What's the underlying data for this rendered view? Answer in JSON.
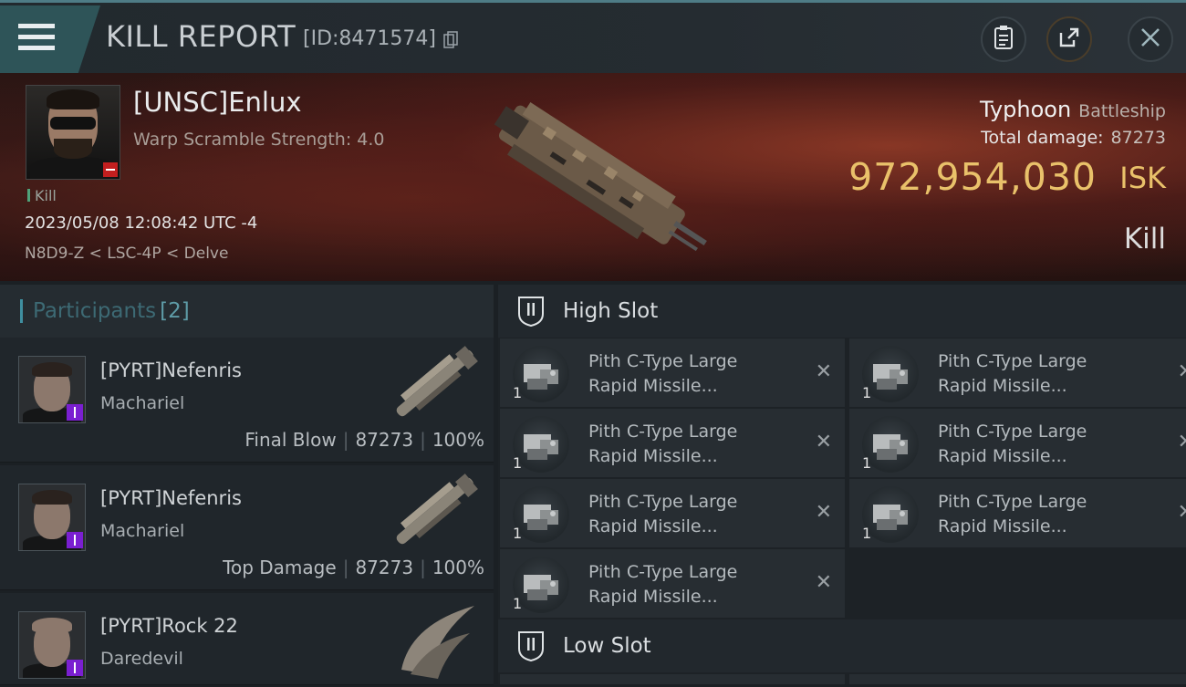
{
  "header": {
    "title": "KILL REPORT",
    "report_id": "[ID:8471574]"
  },
  "icons": {
    "menu": "hamburger-menu-icon",
    "copy": "copy-icon",
    "clipboard": "clipboard-icon",
    "share": "share-icon",
    "close": "close-icon"
  },
  "colors": {
    "accent_teal": "#3f8fa0",
    "isk_gold": "#e9c16a",
    "security_negative": "#c21f1f",
    "corp_purple": "#7a1fd1"
  },
  "victim": {
    "name": "[UNSC]Enlux",
    "detail": "Warp Scramble Strength: 4.0",
    "kill_tag": "Kill",
    "timestamp": "2023/05/08 12:08:42 UTC -4",
    "location": "N8D9-Z < LSC-4P < Delve",
    "ship": "Typhoon",
    "ship_class": "Battleship",
    "total_damage_label": "Total damage:",
    "total_damage": "87273",
    "isk_value": "972,954,030",
    "isk_unit": "ISK",
    "result": "Kill"
  },
  "participants": {
    "title": "Participants",
    "count": "[2]",
    "rows": [
      {
        "name": "[PYRT]Nefenris",
        "ship": "Machariel",
        "role": "Final Blow",
        "damage": "87273",
        "percent": "100%"
      },
      {
        "name": "[PYRT]Nefenris",
        "ship": "Machariel",
        "role": "Top Damage",
        "damage": "87273",
        "percent": "100%"
      },
      {
        "name": "[PYRT]Rock 22",
        "ship": "Daredevil"
      }
    ]
  },
  "fitting": {
    "high_slot": {
      "title": "High Slot",
      "modules": [
        {
          "line1": "Pith C-Type Large",
          "line2": "Rapid Missile...",
          "qty": "1"
        },
        {
          "line1": "Pith C-Type Large",
          "line2": "Rapid Missile...",
          "qty": "1"
        },
        {
          "line1": "Pith C-Type Large",
          "line2": "Rapid Missile...",
          "qty": "1"
        },
        {
          "line1": "Pith C-Type Large",
          "line2": "Rapid Missile...",
          "qty": "1"
        },
        {
          "line1": "Pith C-Type Large",
          "line2": "Rapid Missile...",
          "qty": "1"
        },
        {
          "line1": "Pith C-Type Large",
          "line2": "Rapid Missile...",
          "qty": "1"
        },
        {
          "line1": "Pith C-Type Large",
          "line2": "Rapid Missile...",
          "qty": "1"
        }
      ]
    },
    "low_slot": {
      "title": "Low Slot"
    },
    "remove_glyph": "✕"
  }
}
